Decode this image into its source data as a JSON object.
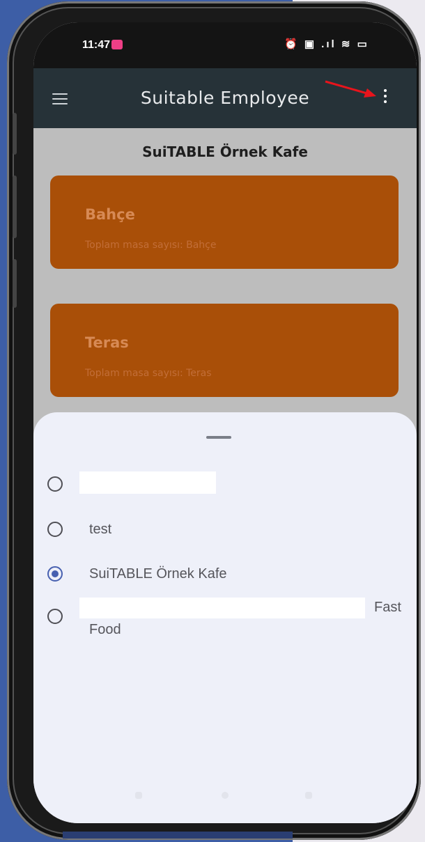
{
  "status_bar": {
    "time": "11:47",
    "icons_text": "⏰ ▣ .ıl ≋ ▭"
  },
  "app_bar": {
    "title": "Suitable Employee",
    "menu_icon": "hamburger-menu-icon",
    "overflow_icon": "more-vert-icon"
  },
  "content": {
    "cafe_title": "SuiTABLE Örnek Kafe",
    "areas": [
      {
        "name": "Bahçe",
        "subtitle": "Toplam masa sayısı: Bahçe"
      },
      {
        "name": "Teras",
        "subtitle": "Toplam masa sayısı: Teras"
      }
    ]
  },
  "sheet": {
    "options": [
      {
        "label": "",
        "selected": false,
        "redacted": true
      },
      {
        "label": "test",
        "selected": false
      },
      {
        "label": "SuiTABLE Örnek Kafe",
        "selected": true
      },
      {
        "label_line1": "Fast",
        "label_line2": "Food",
        "selected": false,
        "partially_redacted": true
      }
    ]
  },
  "colors": {
    "app_bar": "#263238",
    "card": "#a94f08",
    "sheet": "#eef0f9",
    "radio_selected": "#4760b0",
    "annotation_arrow": "#e8141c"
  }
}
